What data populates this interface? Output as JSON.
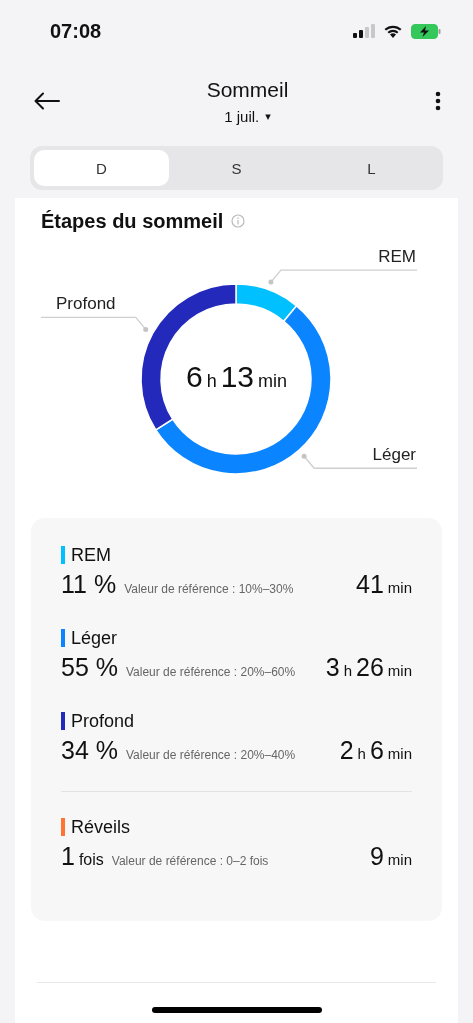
{
  "status_bar": {
    "time": "07:08"
  },
  "header": {
    "title": "Sommeil",
    "date": "1 juil.",
    "date_caret": "▾"
  },
  "tabs": [
    {
      "label": "D",
      "selected": true
    },
    {
      "label": "S",
      "selected": false
    },
    {
      "label": "L",
      "selected": false
    }
  ],
  "stages_section": {
    "title": "Étapes du sommeil",
    "total": [
      {
        "text": "6",
        "kind": "number"
      },
      {
        "text": "h",
        "kind": "unit"
      },
      {
        "text": "13",
        "kind": "number"
      },
      {
        "text": "min",
        "kind": "unit"
      }
    ],
    "chart_data": {
      "type": "donut",
      "categories": [
        "REM",
        "Léger",
        "Profond"
      ],
      "values": [
        11,
        55,
        34
      ]
    }
  },
  "stats": {
    "stages": [
      {
        "name": "REM",
        "color": "#00c0ff",
        "share": [
          {
            "text": "11 %",
            "kind": "number"
          }
        ],
        "reference": "Valeur de référence : 10%–30%",
        "duration": [
          {
            "text": "41",
            "kind": "number"
          },
          {
            "text": "min",
            "kind": "unit"
          }
        ]
      },
      {
        "name": "Léger",
        "color": "#0a84ff",
        "share": [
          {
            "text": "55 %",
            "kind": "number"
          }
        ],
        "reference": "Valeur de référence : 20%–60%",
        "duration": [
          {
            "text": "3",
            "kind": "number"
          },
          {
            "text": "h",
            "kind": "unit"
          },
          {
            "text": "26",
            "kind": "number"
          },
          {
            "text": "min",
            "kind": "unit"
          }
        ]
      },
      {
        "name": "Profond",
        "color": "#2329bb",
        "share": [
          {
            "text": "34 %",
            "kind": "number"
          }
        ],
        "reference": "Valeur de référence : 20%–40%",
        "duration": [
          {
            "text": "2",
            "kind": "number"
          },
          {
            "text": "h",
            "kind": "unit"
          },
          {
            "text": "6",
            "kind": "number"
          },
          {
            "text": "min",
            "kind": "unit"
          }
        ]
      }
    ],
    "awakenings": {
      "name": "Réveils",
      "color": "#ff7433",
      "share": [
        {
          "text": "1",
          "kind": "number"
        },
        {
          "text": "fois",
          "kind": "unit"
        }
      ],
      "reference": "Valeur de référence : 0–2 fois",
      "duration": [
        {
          "text": "9",
          "kind": "number"
        },
        {
          "text": "min",
          "kind": "unit"
        }
      ]
    }
  }
}
